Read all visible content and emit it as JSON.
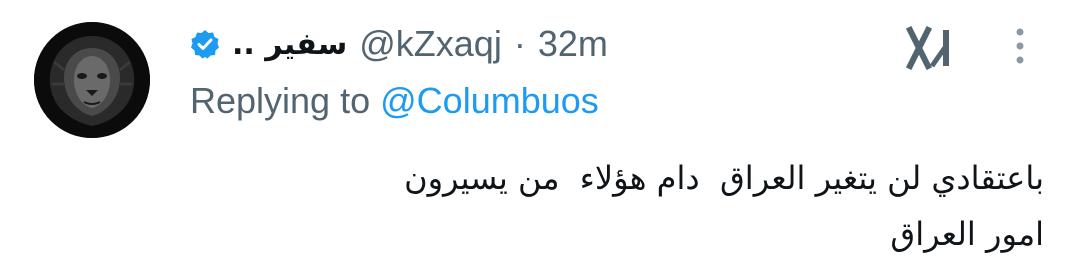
{
  "tweet": {
    "author": {
      "display_name": "سفير ..",
      "handle": "@kZxaqj",
      "verified": true,
      "avatar_icon": "lion-avatar"
    },
    "separator": "·",
    "timestamp": "32m",
    "reply": {
      "prefix": "Replying to",
      "mention": "@Columbuos"
    },
    "text": "باعتقادي لن يتغير العراق  دام هؤلاء  من يسيرون\nامور العراق",
    "icons": {
      "verified": "verified-badge-icon",
      "grok": "grok-icon",
      "more": "more-options-icon"
    },
    "colors": {
      "accent": "#1d9bf0",
      "secondary_text": "#536471",
      "primary_text": "#0f1419"
    }
  }
}
